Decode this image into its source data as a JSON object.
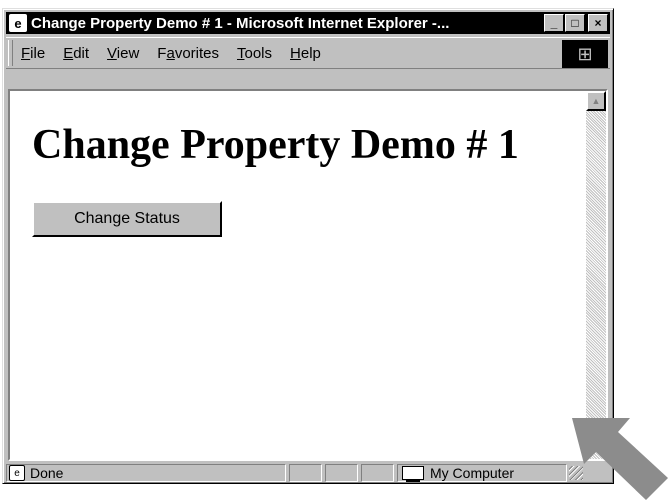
{
  "window": {
    "title": "Change Property Demo # 1 - Microsoft Internet Explorer -...",
    "icon": "ie-page-icon",
    "controls": {
      "minimize": "_",
      "maximize": "□",
      "close": "×"
    }
  },
  "menubar": {
    "items": [
      {
        "label": "File",
        "underline_index": 0
      },
      {
        "label": "Edit",
        "underline_index": 0
      },
      {
        "label": "View",
        "underline_index": 0
      },
      {
        "label": "Favorites",
        "underline_index": 1
      },
      {
        "label": "Tools",
        "underline_index": 0
      },
      {
        "label": "Help",
        "underline_index": 0
      }
    ],
    "logo": "windows-logo-icon"
  },
  "page": {
    "heading": "Change Property Demo # 1",
    "button_label": "Change Status"
  },
  "statusbar": {
    "text": "Done",
    "zone": "My Computer"
  },
  "colors": {
    "titlebar": "#000000",
    "chrome": "#c0c0c0",
    "arrow": "#8c8c8c"
  }
}
